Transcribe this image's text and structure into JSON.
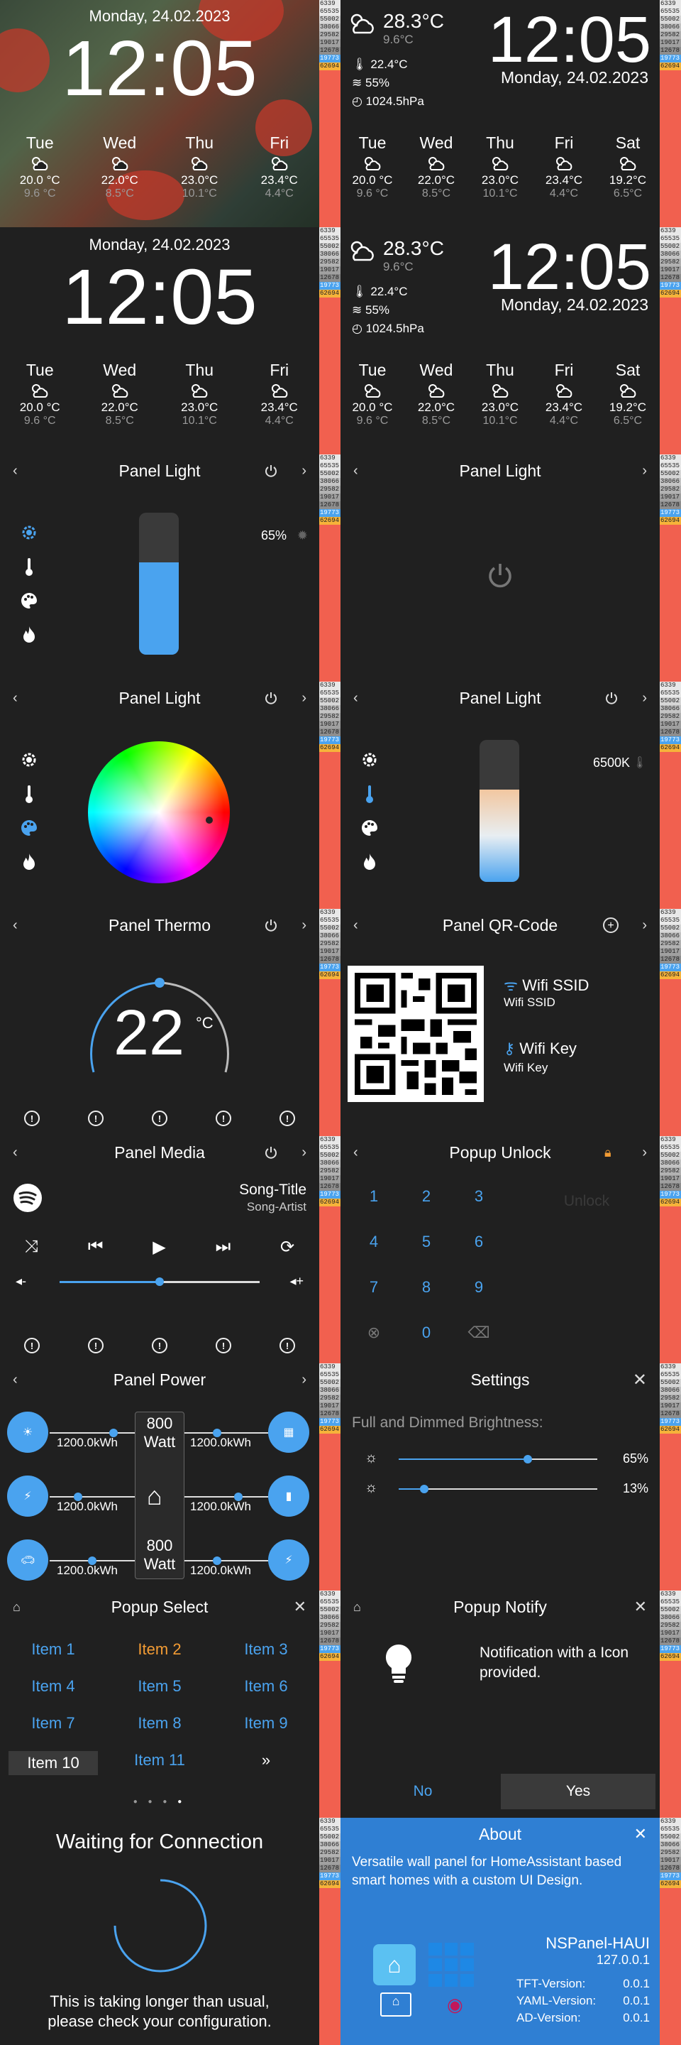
{
  "strip_values": [
    "6339",
    "65535",
    "55002",
    "38066",
    "29582",
    "19017",
    "12678",
    "19773",
    "62694"
  ],
  "clock": {
    "date": "Monday, 24.02.2023",
    "time": "12:05"
  },
  "current": {
    "temp": "28.3°C",
    "feel": "9.6°C",
    "humidity_temp": "22.4°C",
    "wind": "55%",
    "pressure": "1024.5hPa"
  },
  "forecast4": [
    {
      "day": "Tue",
      "hi": "20.0 °C",
      "lo": "9.6 °C"
    },
    {
      "day": "Wed",
      "hi": "22.0°C",
      "lo": "8.5°C"
    },
    {
      "day": "Thu",
      "hi": "23.0°C",
      "lo": "10.1°C"
    },
    {
      "day": "Fri",
      "hi": "23.4°C",
      "lo": "4.4°C"
    }
  ],
  "forecast5": [
    {
      "day": "Tue",
      "hi": "20.0 °C",
      "lo": "9.6 °C"
    },
    {
      "day": "Wed",
      "hi": "22.0°C",
      "lo": "8.5°C"
    },
    {
      "day": "Thu",
      "hi": "23.0°C",
      "lo": "10.1°C"
    },
    {
      "day": "Fri",
      "hi": "23.4°C",
      "lo": "4.4°C"
    },
    {
      "day": "Sat",
      "hi": "19.2°C",
      "lo": "6.5°C"
    }
  ],
  "light": {
    "title": "Panel Light",
    "brightness": "65%",
    "brightness_level": 0.65,
    "kelvin": "6500K"
  },
  "thermo": {
    "title": "Panel Thermo",
    "value": "22",
    "unit": "°C"
  },
  "qr": {
    "title": "Panel QR-Code",
    "ssid_label": "Wifi SSID",
    "ssid_value": "Wifi SSID",
    "key_label": "Wifi Key",
    "key_value": "Wifi Key"
  },
  "media": {
    "title": "Panel Media",
    "song_title": "Song-Title",
    "song_artist": "Song-Artist",
    "volume": 0.5
  },
  "unlock": {
    "title": "Popup Unlock",
    "keys": [
      "1",
      "2",
      "3",
      "4",
      "5",
      "6",
      "7",
      "8",
      "9",
      "0"
    ],
    "unlock_label": "Unlock"
  },
  "power": {
    "title": "Panel Power",
    "values": [
      "1200.0kWh",
      "1200.0kWh",
      "1200.0kWh",
      "1200.0kWh",
      "1200.0kWh",
      "1200.0kWh"
    ],
    "top": "800",
    "top_unit": "Watt",
    "bottom": "800",
    "bottom_unit": "Watt"
  },
  "settings": {
    "title": "Settings",
    "label": "Full and Dimmed Brightness:",
    "full": "65%",
    "dimmed": "13%",
    "full_level": 0.65,
    "dimmed_level": 0.13
  },
  "select": {
    "title": "Popup Select",
    "items": [
      "Item 1",
      "Item 2",
      "Item 3",
      "Item 4",
      "Item 5",
      "Item 6",
      "Item 7",
      "Item 8",
      "Item 9",
      "Item 10",
      "Item 11"
    ],
    "next": "»"
  },
  "notify": {
    "title": "Popup Notify",
    "text": "Notification with a Icon provided.",
    "no": "No",
    "yes": "Yes"
  },
  "waiting": {
    "title": "Waiting for Connection",
    "msg1": "This is taking longer than usual,",
    "msg2": "please check your configuration."
  },
  "about": {
    "title": "About",
    "desc": "Versatile wall panel for HomeAssistant based smart homes with a  custom UI Design.",
    "name": "NSPanel-HAUI",
    "version": "127.0.0.1",
    "tft": "TFT-Version:",
    "tft_v": "0.0.1",
    "yaml": "YAML-Version:",
    "yaml_v": "0.0.1",
    "ad": "AD-Version:",
    "ad_v": "0.0.1"
  },
  "colors": {
    "accent": "#4aa3ef",
    "orange": "#f39c34",
    "panel_bg": "#202020",
    "about_bg": "#2f7fd3"
  }
}
